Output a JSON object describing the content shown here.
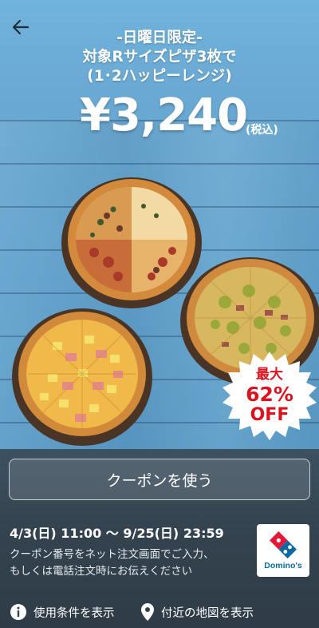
{
  "header": {
    "back_icon": "arrow-left-icon",
    "headline": [
      "-日曜日限定-",
      "対象Rサイズピザ3枚で",
      "(1･2ハッピーレンジ)"
    ]
  },
  "offer": {
    "price": "¥3,240",
    "tax_note": "(税込)",
    "badge": [
      "最大",
      "62%",
      "OFF"
    ]
  },
  "coupon": {
    "use_button": "クーポンを使う",
    "period": "4/3(日) 11:00  〜  9/25(日) 23:59",
    "instructions": [
      "クーポン番号をネット注文画面でご入力、",
      "もしくは電話注文時にお伝えください"
    ],
    "brand_name": "Domino's"
  },
  "footer": {
    "terms_link": "使用条件を表示",
    "terms_icon": "info-icon",
    "map_link": "付近の地図を表示",
    "map_icon": "map-pin-icon"
  },
  "colors": {
    "sky": "#6aa9d3",
    "panel": "#34434f",
    "badge_red": "#d9141f",
    "dominos_blue": "#0b6aa3",
    "dominos_red": "#e31837"
  }
}
